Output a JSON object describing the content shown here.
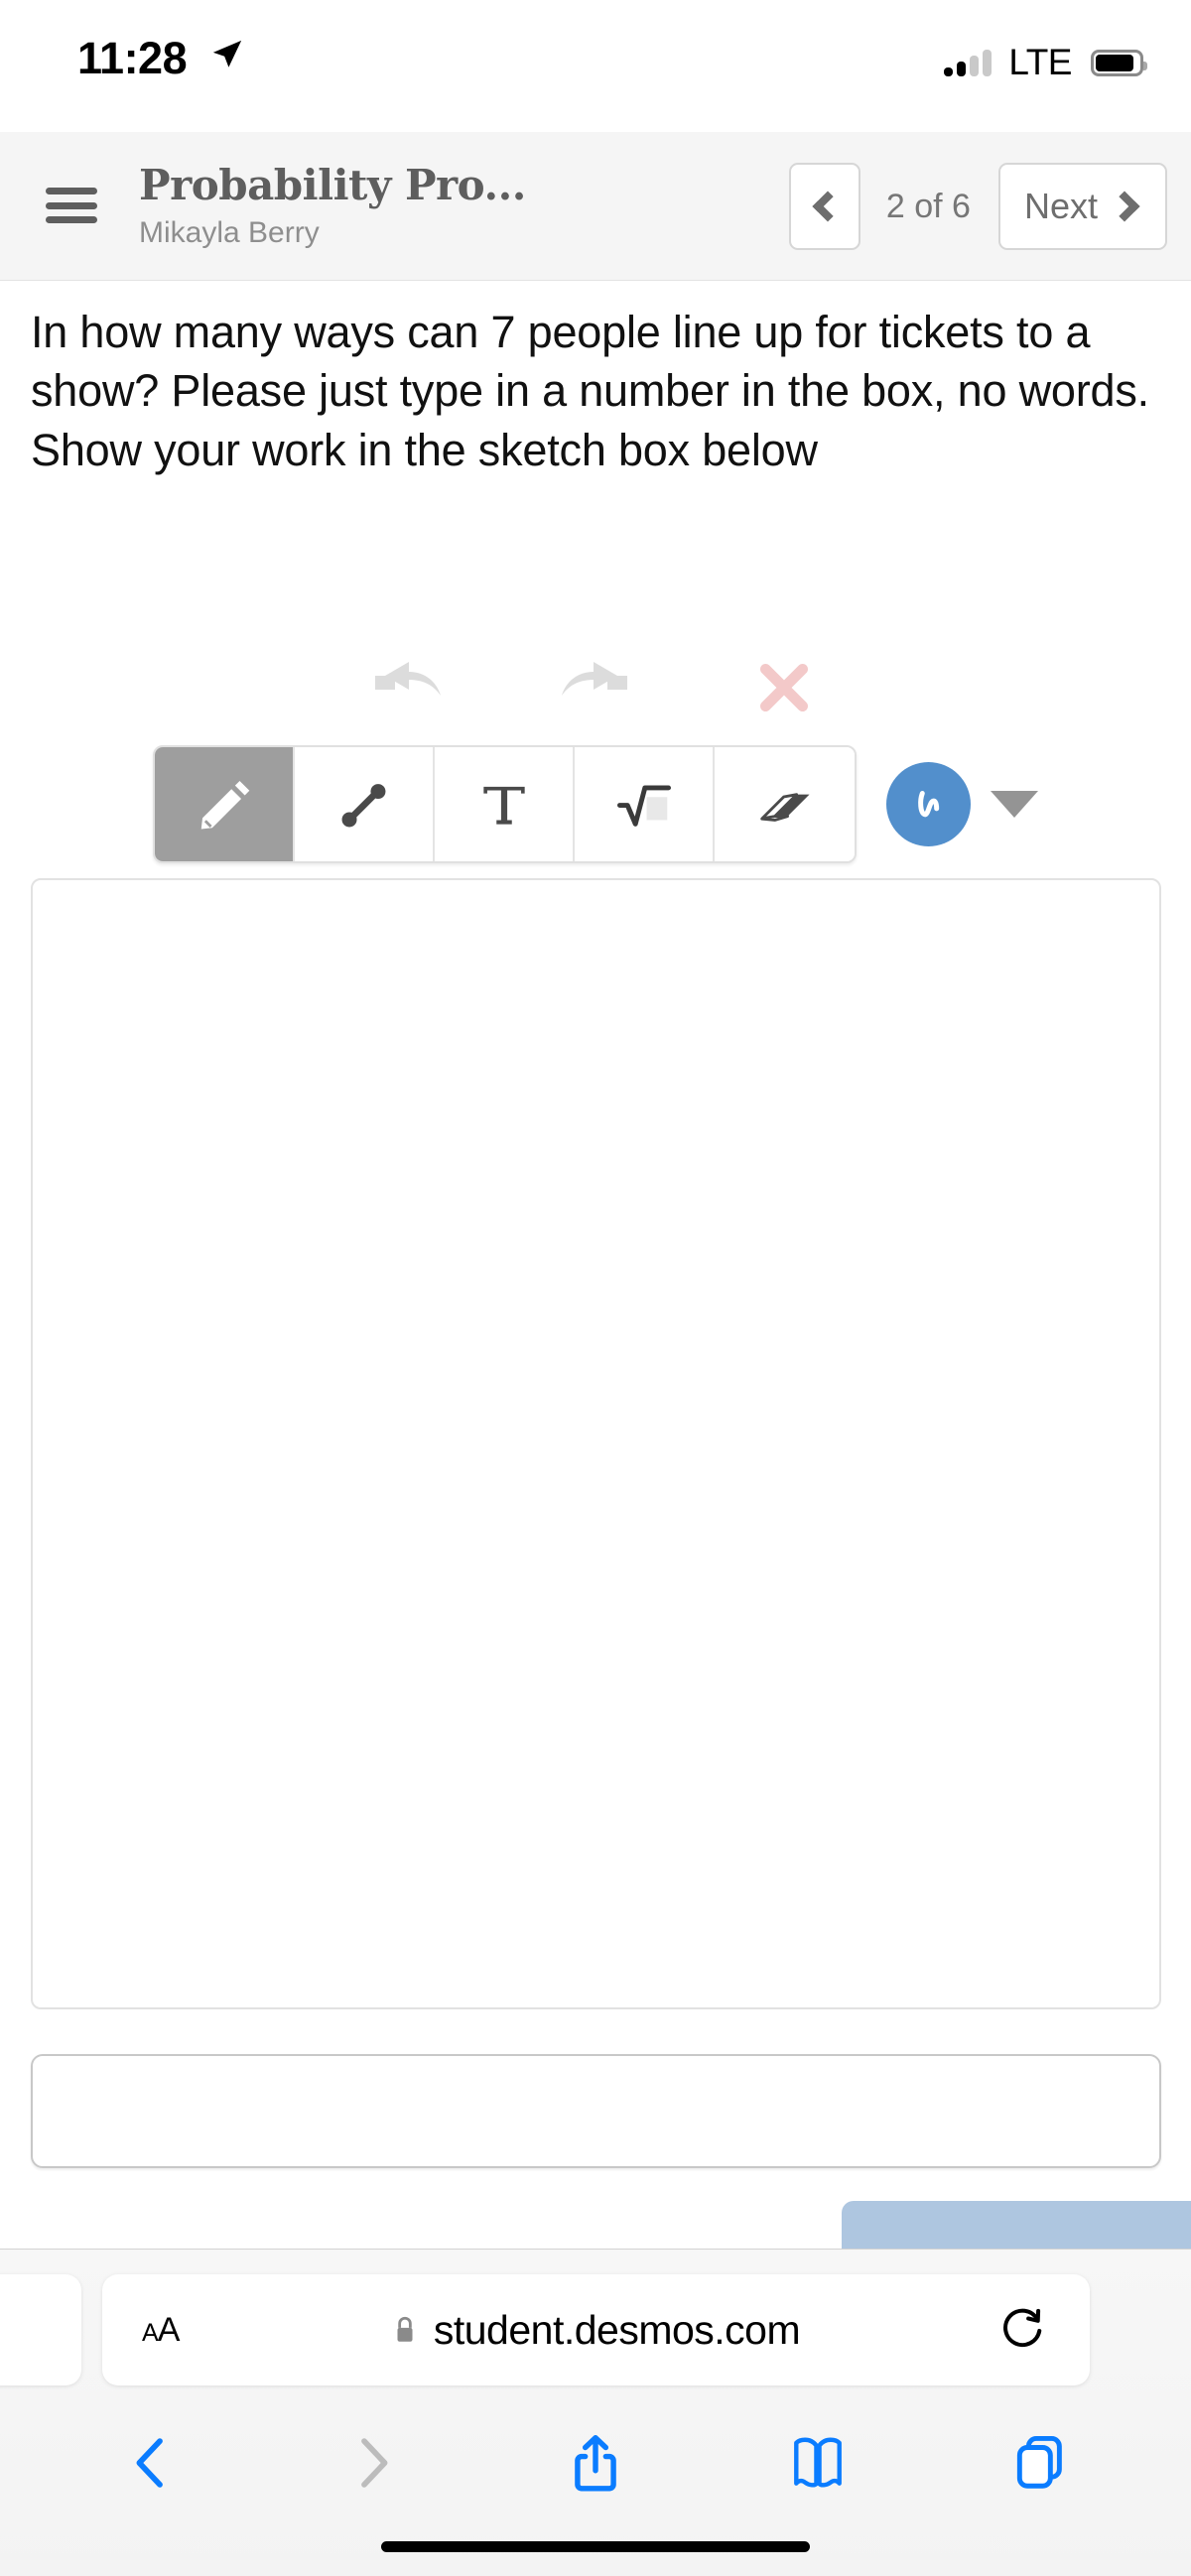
{
  "status_bar": {
    "time": "11:28",
    "location_icon": "location-arrow-icon",
    "network_label": "LTE",
    "signal_icon": "signal-bars-icon",
    "battery_icon": "battery-icon",
    "battery_level_percent": 85
  },
  "app_header": {
    "menu_icon": "hamburger-menu-icon",
    "title": "Probability Pro...",
    "subtitle": "Mikayla Berry",
    "prev_icon": "chevron-left-icon",
    "page_indicator": "2 of 6",
    "next_label": "Next",
    "next_icon": "chevron-right-icon",
    "background_color": "#f5f5f5",
    "title_color": "#5e5e5e"
  },
  "question": {
    "text": "In how many ways can 7 people line up for tickets to a show? Please just type in a number in the box, no words. Show your work in the sketch box below"
  },
  "edit_actions": [
    {
      "name": "undo",
      "icon": "undo-arrow-icon",
      "color": "#dcdcdc",
      "enabled": false
    },
    {
      "name": "redo",
      "icon": "redo-arrow-icon",
      "color": "#dcdcdc",
      "enabled": false
    },
    {
      "name": "clear",
      "icon": "close-x-icon",
      "color": "#f3c9c9",
      "enabled": true
    }
  ],
  "tools": [
    {
      "name": "pencil",
      "icon": "pencil-icon",
      "label": "",
      "selected": true
    },
    {
      "name": "segment",
      "icon": "line-segment-icon",
      "label": "",
      "selected": false
    },
    {
      "name": "text",
      "icon": "text-t-icon",
      "label": "T",
      "selected": false
    },
    {
      "name": "math",
      "icon": "square-root-icon",
      "label": "",
      "selected": false
    },
    {
      "name": "eraser",
      "icon": "eraser-icon",
      "label": "",
      "selected": false
    }
  ],
  "style_picker": {
    "icon": "squiggle-stroke-icon",
    "color": "#528fcc",
    "caret_icon": "caret-down-icon",
    "caret_color": "#949494"
  },
  "sketch_canvas": {
    "name": "sketch-canvas",
    "content": "",
    "border_color": "#e2e2e2"
  },
  "answer": {
    "value": "",
    "placeholder": ""
  },
  "submit": {
    "label": "",
    "color": "#aec6e0"
  },
  "safari": {
    "text_size_label": "A",
    "text_size_label_small": "A",
    "lock_icon": "lock-icon",
    "url": "student.desmos.com",
    "reload_icon": "reload-icon",
    "toolbar": [
      {
        "name": "back",
        "icon": "chevron-left-icon",
        "color": "#0a7cff",
        "enabled": true
      },
      {
        "name": "forward",
        "icon": "chevron-right-icon",
        "color": "#bcbcbc",
        "enabled": false
      },
      {
        "name": "share",
        "icon": "share-up-arrow-icon",
        "color": "#0a7cff",
        "enabled": true
      },
      {
        "name": "bookmarks",
        "icon": "book-icon",
        "color": "#0a7cff",
        "enabled": true
      },
      {
        "name": "tabs",
        "icon": "tabs-icon",
        "color": "#0a7cff",
        "enabled": true
      }
    ]
  }
}
